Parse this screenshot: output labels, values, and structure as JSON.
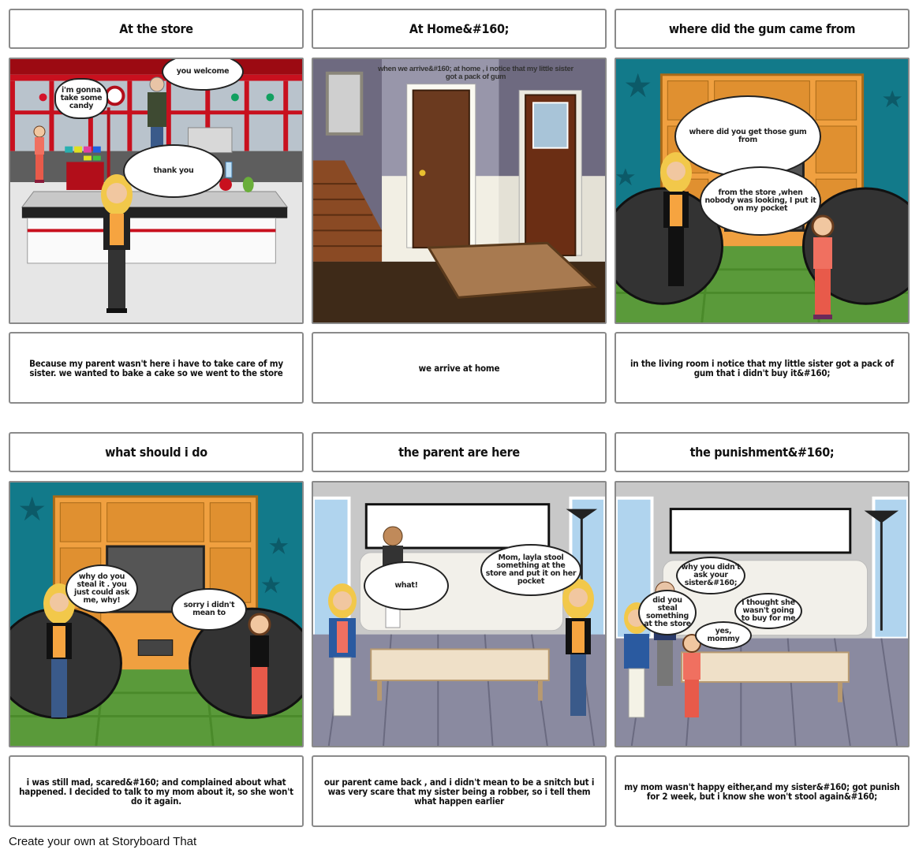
{
  "panels": [
    {
      "title": "At the store",
      "caption": "Because my parent wasn't here i have to take care of my sister. we wanted to bake a cake so we went to the store",
      "scene": "store-checkout",
      "dialogue": [
        {
          "speaker": "sister",
          "type": "thought",
          "text": "i'm gonna take some candy"
        },
        {
          "speaker": "cashier",
          "type": "speech",
          "text": "you welcome"
        },
        {
          "speaker": "narrator",
          "type": "speech",
          "text": "thank you"
        }
      ]
    },
    {
      "title": "At Home&#160;",
      "caption": "we arrive at home",
      "scene": "home-entrance",
      "overlay_text": "when we arrive&#160; at home , i notice that my little sister got a pack of gum",
      "dialogue": []
    },
    {
      "title": "where did the gum came from",
      "caption": "in the living room i notice that my little sister got a pack of gum that i didn't buy it&#160;",
      "scene": "living-room-tv",
      "dialogue": [
        {
          "speaker": "narrator",
          "type": "speech",
          "text": "where did you get those gum from"
        },
        {
          "speaker": "sister",
          "type": "speech",
          "text": "from the store ,when nobody was looking, I put it on my pocket"
        }
      ]
    },
    {
      "title": "what should i do",
      "caption": "i was still mad, scared&#160; and complained about what happened. I decided to talk to my mom about it, so she won't do it again.",
      "scene": "living-room-tv",
      "dialogue": [
        {
          "speaker": "narrator",
          "type": "speech",
          "text": "why do you steal it . you just could ask me, why!"
        },
        {
          "speaker": "sister",
          "type": "speech",
          "text": "sorry i didn't mean to"
        }
      ]
    },
    {
      "title": "the parent are here",
      "caption": "our parent came back , and i didn't mean to be a snitch but i was very scare that my sister being a robber, so i tell them what happen earlier",
      "scene": "living-room-sofa",
      "dialogue": [
        {
          "speaker": "mom",
          "type": "speech",
          "text": "what!"
        },
        {
          "speaker": "narrator",
          "type": "speech",
          "text": "Mom, layla stool something at the store and put it on her pocket"
        }
      ]
    },
    {
      "title": "the punishment&#160;",
      "caption": "my mom wasn't happy either,and my sister&#160; got punish for 2 week, but i know she won't stool again&#160;",
      "scene": "living-room-sofa",
      "dialogue": [
        {
          "speaker": "dad",
          "type": "speech",
          "text": "why you didn't ask your sister&#160;"
        },
        {
          "speaker": "mom",
          "type": "speech",
          "text": "did you steal something at the store"
        },
        {
          "speaker": "narrator",
          "type": "speech",
          "text": "i thought she wasn't going to buy for me"
        },
        {
          "speaker": "sister",
          "type": "speech",
          "text": "yes, mommy"
        }
      ]
    }
  ],
  "footer": "Create your own at Storyboard That",
  "colors": {
    "store_red": "#c8101e",
    "teal_wall": "#127a8a",
    "shelf_orange": "#f0a040",
    "floor_green": "#5a9a3a",
    "sofa_white": "#f2f0ea",
    "wall_purple": "#8e8a9e",
    "door_brown": "#6b3a1f"
  }
}
